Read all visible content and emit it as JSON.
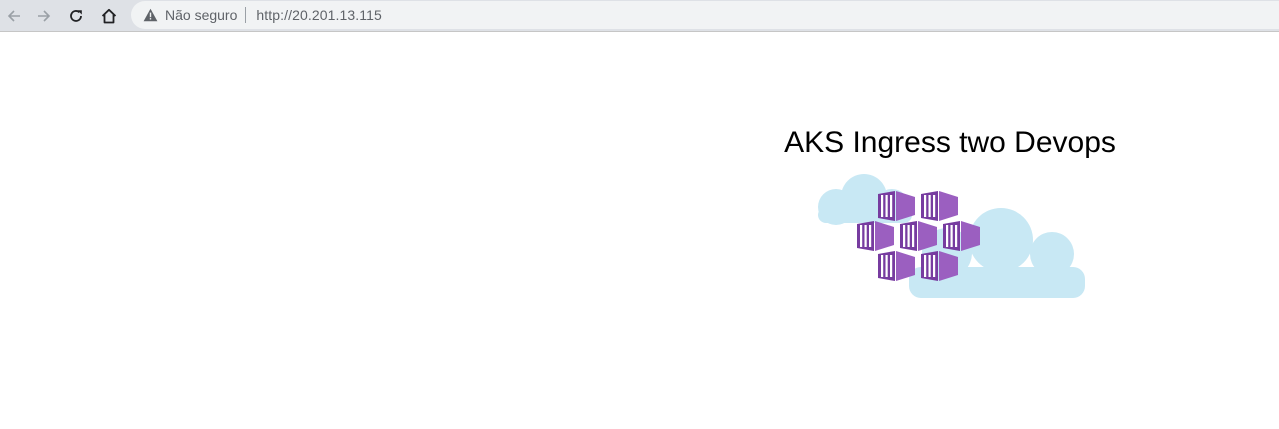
{
  "browser": {
    "security_label": "Não seguro",
    "url": "http://20.201.13.115",
    "icons": {
      "back": "arrow-left-icon",
      "forward": "arrow-right-icon",
      "reload": "reload-icon",
      "home": "home-icon",
      "security": "warning-triangle-icon"
    }
  },
  "page": {
    "heading": "AKS Ingress two Devops",
    "logo": "azure-kubernetes-containers-cloud-logo"
  },
  "colors": {
    "cloud": "#c8e8f4",
    "container_dark": "#773ca0",
    "container_light": "#9b5fc0",
    "toolbar": "#dee1e6",
    "omnibox": "#f1f3f4"
  }
}
